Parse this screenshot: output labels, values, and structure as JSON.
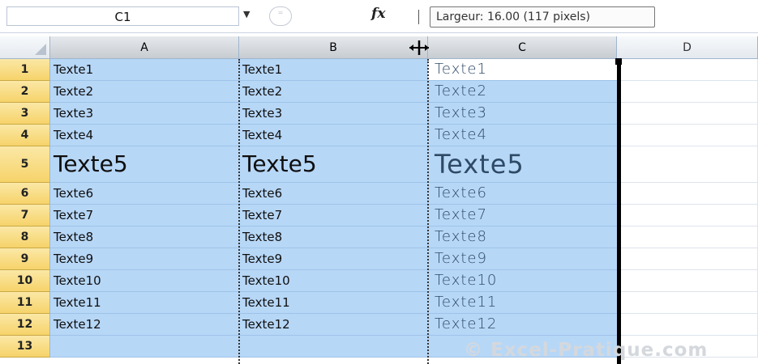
{
  "formula_bar": {
    "name_box": "C1",
    "fx_label": "fx",
    "tooltip": "Largeur: 16.00 (117 pixels)"
  },
  "columns": [
    "A",
    "B",
    "C",
    "D"
  ],
  "rows": [
    {
      "num": "1",
      "a": "Texte1",
      "b": "Texte1",
      "c": "Texte1"
    },
    {
      "num": "2",
      "a": "Texte2",
      "b": "Texte2",
      "c": "Texte2"
    },
    {
      "num": "3",
      "a": "Texte3",
      "b": "Texte3",
      "c": "Texte3"
    },
    {
      "num": "4",
      "a": "Texte4",
      "b": "Texte4",
      "c": "Texte4"
    },
    {
      "num": "5",
      "a": "Texte5",
      "b": "Texte5",
      "c": "Texte5"
    },
    {
      "num": "6",
      "a": "Texte6",
      "b": "Texte6",
      "c": "Texte6"
    },
    {
      "num": "7",
      "a": "Texte7",
      "b": "Texte7",
      "c": "Texte7"
    },
    {
      "num": "8",
      "a": "Texte8",
      "b": "Texte8",
      "c": "Texte8"
    },
    {
      "num": "9",
      "a": "Texte9",
      "b": "Texte9",
      "c": "Texte9"
    },
    {
      "num": "10",
      "a": "Texte10",
      "b": "Texte10",
      "c": "Texte10"
    },
    {
      "num": "11",
      "a": "Texte11",
      "b": "Texte11",
      "c": "Texte11"
    },
    {
      "num": "12",
      "a": "Texte12",
      "b": "Texte12",
      "c": "Texte12"
    },
    {
      "num": "13",
      "a": "",
      "b": "",
      "c": ""
    }
  ],
  "watermark": "© Excel-Pratique.com",
  "colors": {
    "selection": "#b7d7f7",
    "row_header": "#f6d36a",
    "column_header_selected": "#d0d5da"
  }
}
